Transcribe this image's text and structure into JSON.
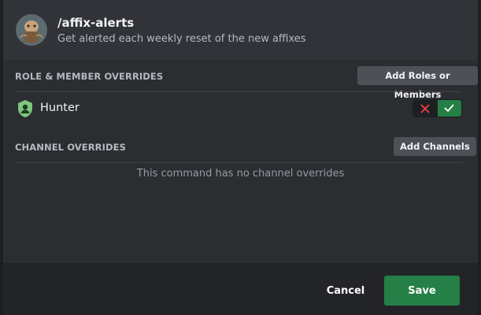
{
  "command": {
    "name": "/affix-alerts",
    "description": "Get alerted each weekly reset of the new affixes"
  },
  "role_section": {
    "label": "ROLE & MEMBER OVERRIDES",
    "add_button": "Add Roles or Members",
    "overrides": [
      {
        "name": "Hunter",
        "icon": "role-shield-icon",
        "state": "allowed",
        "color": "#7ec57e"
      }
    ]
  },
  "channel_section": {
    "label": "CHANNEL OVERRIDES",
    "add_button": "Add Channels",
    "empty_text": "This command has no channel overrides"
  },
  "footer": {
    "cancel_label": "Cancel",
    "save_label": "Save"
  },
  "colors": {
    "accent_green": "#248046",
    "deny_red": "#f23f43"
  }
}
